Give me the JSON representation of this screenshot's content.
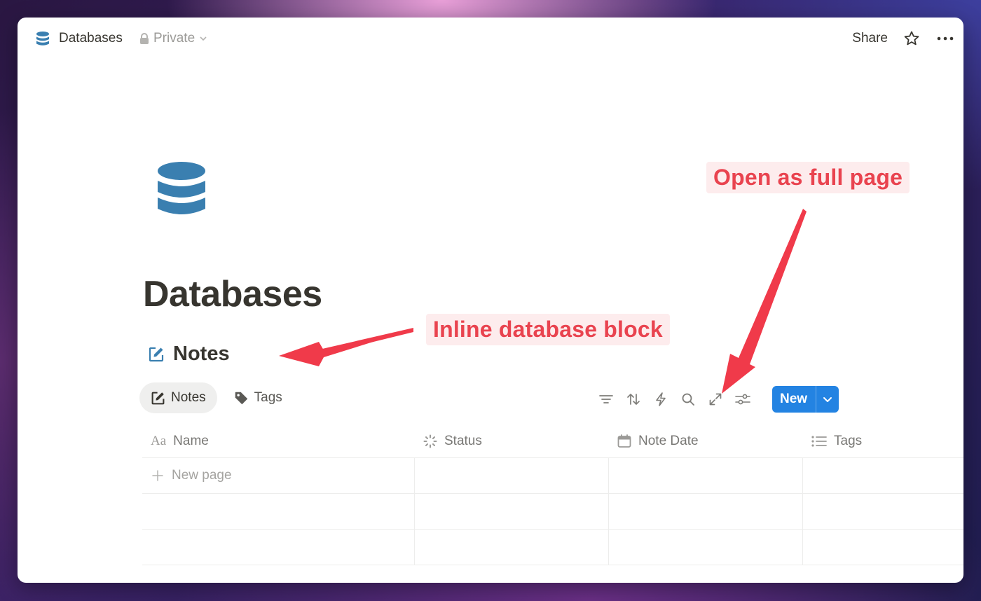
{
  "topbar": {
    "title": "Databases",
    "privacy": "Private",
    "share_label": "Share"
  },
  "page": {
    "title": "Databases",
    "database_title": "Notes"
  },
  "views": [
    {
      "label": "Notes",
      "active": true
    },
    {
      "label": "Tags",
      "active": false
    }
  ],
  "toolbar": {
    "new_label": "New"
  },
  "table": {
    "columns": [
      "Name",
      "Status",
      "Note Date",
      "Tags"
    ],
    "new_row_label": "New page"
  },
  "annotations": {
    "full_page": "Open as full page",
    "inline_block": "Inline database block"
  },
  "colors": {
    "accent": "#2383e2",
    "db_icon": "#3a7fb0",
    "annotation_text": "#e9434f",
    "annotation_bg": "#fdeced"
  },
  "icons": [
    "database-icon",
    "lock-icon",
    "chevron-down-icon",
    "star-icon",
    "more-icon",
    "edit-icon",
    "tag-icon",
    "filter-icon",
    "sort-icon",
    "lightning-icon",
    "search-icon",
    "expand-icon",
    "settings-icon"
  ]
}
